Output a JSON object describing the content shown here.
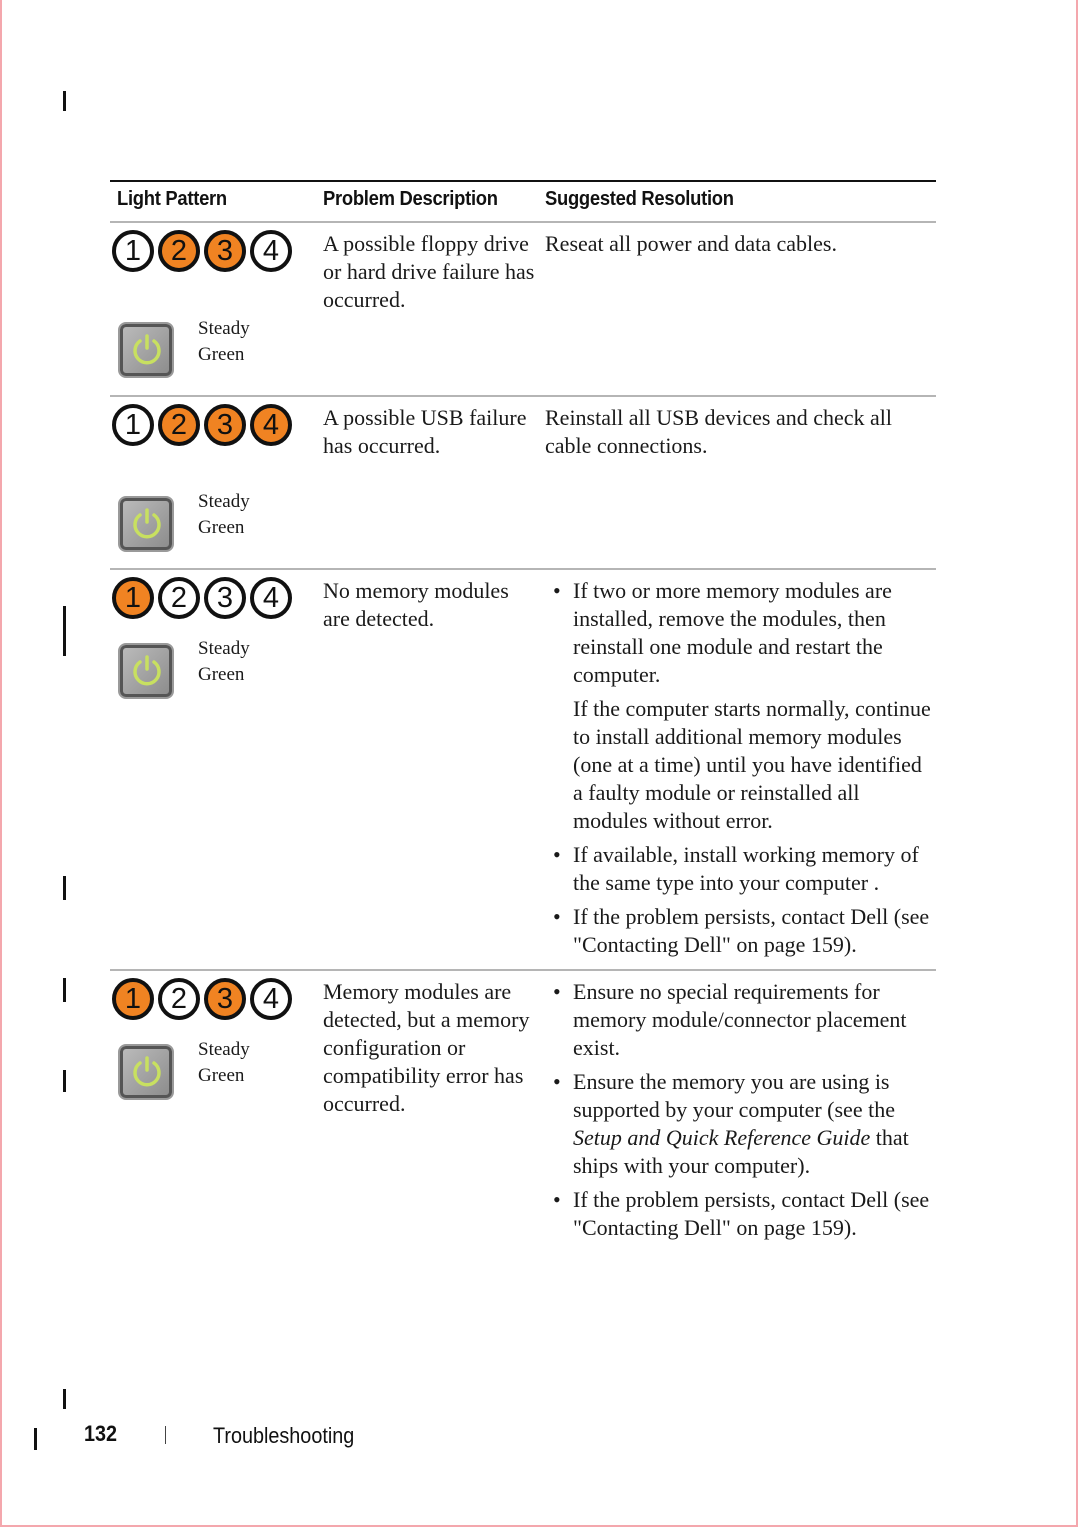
{
  "table": {
    "headers": [
      "Light Pattern",
      "Problem Description",
      "Suggested Resolution"
    ],
    "rows": [
      {
        "lights": [
          {
            "label": "1",
            "on": false
          },
          {
            "label": "2",
            "on": true
          },
          {
            "label": "3",
            "on": true
          },
          {
            "label": "4",
            "on": false
          }
        ],
        "power_state_line1": "Steady",
        "power_state_line2": "Green",
        "description": "A possible floppy drive or hard drive failure has occurred.",
        "resolution": "Reseat all power and data cables."
      },
      {
        "lights": [
          {
            "label": "1",
            "on": false
          },
          {
            "label": "2",
            "on": true
          },
          {
            "label": "3",
            "on": true
          },
          {
            "label": "4",
            "on": true
          }
        ],
        "power_state_line1": "Steady",
        "power_state_line2": "Green",
        "description": "A possible USB failure has occurred.",
        "resolution": "Reinstall all USB devices and check all cable connections."
      },
      {
        "lights": [
          {
            "label": "1",
            "on": true
          },
          {
            "label": "2",
            "on": false
          },
          {
            "label": "3",
            "on": false
          },
          {
            "label": "4",
            "on": false
          }
        ],
        "power_state_line1": "Steady",
        "power_state_line2": "Green",
        "description": "No memory modules are detected.",
        "bullets": [
          "If two or more memory modules are installed, remove the modules, then reinstall one module and restart the computer.",
          "If available, install working memory of the same type into your computer .",
          "If the problem persists, contact Dell (see \"Contacting Dell\" on page 159)."
        ],
        "bullet1_followup": "If the computer starts normally, continue to install additional memory modules (one at a time) until you have identified a faulty module or reinstalled all modules without error."
      },
      {
        "lights": [
          {
            "label": "1",
            "on": true
          },
          {
            "label": "2",
            "on": false
          },
          {
            "label": "3",
            "on": true
          },
          {
            "label": "4",
            "on": false
          }
        ],
        "power_state_line1": "Steady",
        "power_state_line2": "Green",
        "description": "Memory modules are detected, but a memory configuration or compatibility error has occurred.",
        "bullets": [
          "Ensure no special requirements for memory module/connector placement exist.",
          "Ensure the memory you are using is supported by your computer (see the",
          "If the problem persists, contact Dell (see \"Contacting Dell\" on page 159)."
        ],
        "bullet2_italic": "Setup and Quick Reference Guide",
        "bullet2_tail": " that ships with your computer)."
      }
    ]
  },
  "colors": {
    "light_on": "#f08322",
    "power_glow": "#c8e060",
    "page_border": "#f4a7ad"
  },
  "footer": {
    "page_number": "132",
    "section": "Troubleshooting"
  }
}
